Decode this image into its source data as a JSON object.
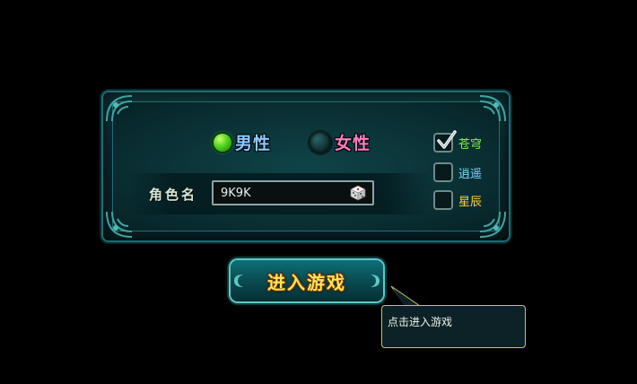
{
  "gender": {
    "male_label": "男性",
    "female_label": "女性",
    "selected": "male"
  },
  "name": {
    "label": "角色名",
    "value": "9K9K"
  },
  "servers": [
    {
      "label": "苍穹",
      "checked": true,
      "color": "#7cff4a"
    },
    {
      "label": "逍遥",
      "checked": false,
      "color": "#7ad6ff"
    },
    {
      "label": "星辰",
      "checked": false,
      "color": "#ffd23a"
    }
  ],
  "enter_button": {
    "label": "进入游戏"
  },
  "tooltip": {
    "text": "点击进入游戏"
  },
  "icons": {
    "random_name": "dice-icon",
    "check": "checkmark-icon"
  },
  "colors": {
    "panel_border": "#1e6d72",
    "button_text": "#ffe45a",
    "tooltip_border": "#c4c650"
  }
}
